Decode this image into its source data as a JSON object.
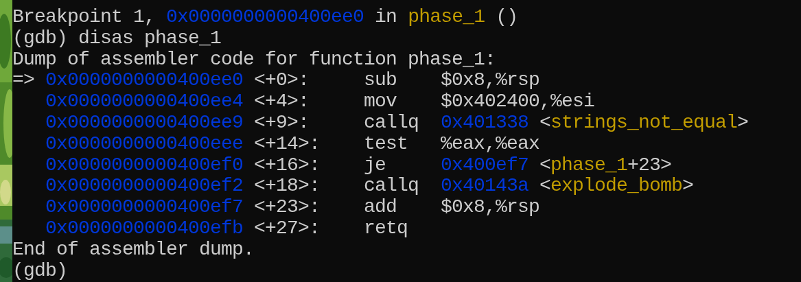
{
  "terminal": {
    "lines": [
      {
        "kind": "breakpoint",
        "prefix": "Breakpoint 1,",
        "address": "0x0000000000400ee0",
        "word": "in",
        "function": "phase_1",
        "args": "()"
      },
      {
        "kind": "text",
        "text": "(gdb) disas phase_1"
      },
      {
        "kind": "text",
        "text": "Dump of assembler code for function phase_1:"
      },
      {
        "kind": "instruction",
        "marker": "=>",
        "address": "0x0000000000400ee0",
        "offset": "<+0>:",
        "mnemonic": "sub",
        "operand": {
          "kind": "plain",
          "text": "$0x8,%rsp"
        }
      },
      {
        "kind": "instruction",
        "address": "0x0000000000400ee4",
        "offset": "<+4>:",
        "mnemonic": "mov",
        "operand": {
          "kind": "plain",
          "text": "$0x402400,%esi"
        }
      },
      {
        "kind": "instruction",
        "address": "0x0000000000400ee9",
        "offset": "<+9>:",
        "mnemonic": "callq",
        "operand": {
          "kind": "ref",
          "address": "0x401338",
          "open": "<",
          "symbol": "strings_not_equal",
          "close": ">"
        }
      },
      {
        "kind": "instruction",
        "address": "0x0000000000400eee",
        "offset": "<+14>:",
        "mnemonic": "test",
        "operand": {
          "kind": "plain",
          "text": "%eax,%eax"
        }
      },
      {
        "kind": "instruction",
        "address": "0x0000000000400ef0",
        "offset": "<+16>:",
        "mnemonic": "je",
        "operand": {
          "kind": "ref",
          "address": "0x400ef7",
          "open": "<",
          "symbol": "phase_1",
          "close": "+23>"
        }
      },
      {
        "kind": "instruction",
        "address": "0x0000000000400ef2",
        "offset": "<+18>:",
        "mnemonic": "callq",
        "operand": {
          "kind": "ref",
          "address": "0x40143a",
          "open": "<",
          "symbol": "explode_bomb",
          "close": ">"
        }
      },
      {
        "kind": "instruction",
        "address": "0x0000000000400ef7",
        "offset": "<+23>:",
        "mnemonic": "add",
        "operand": {
          "kind": "plain",
          "text": "$0x8,%rsp"
        }
      },
      {
        "kind": "instruction",
        "address": "0x0000000000400efb",
        "offset": "<+27>:",
        "mnemonic": "retq"
      },
      {
        "kind": "text",
        "text": "End of assembler dump."
      },
      {
        "kind": "text",
        "text": "(gdb)"
      }
    ]
  }
}
